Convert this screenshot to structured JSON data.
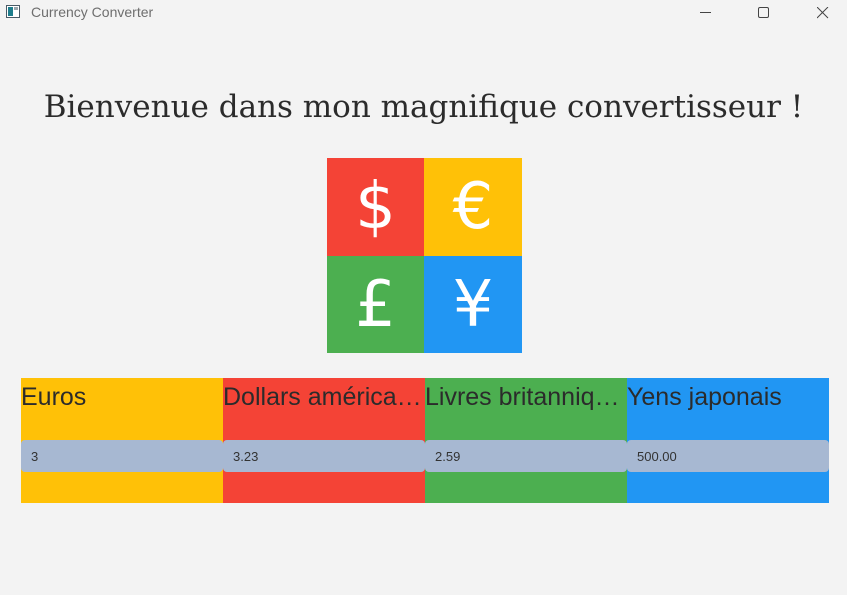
{
  "window": {
    "title": "Currency Converter"
  },
  "heading": "Bienvenue dans mon magnifique convertisseur !",
  "logo": {
    "symbols": [
      "$",
      "€",
      "£",
      "¥"
    ],
    "colors": [
      "#f44336",
      "#ffc107",
      "#4caf50",
      "#2196f3"
    ]
  },
  "currencies": [
    {
      "label": "Euros",
      "value": "3",
      "color": "#ffc107"
    },
    {
      "label": "Dollars américains",
      "value": "3.23",
      "color": "#f44336"
    },
    {
      "label": "Livres britanniques",
      "value": "2.59",
      "color": "#4caf50"
    },
    {
      "label": "Yens japonais",
      "value": "500.00",
      "color": "#2196f3"
    }
  ],
  "input_background": "#a7b8d2",
  "icons": {
    "app": "app-window-icon",
    "minimize": "minimize-icon",
    "maximize": "maximize-icon",
    "close": "close-icon"
  }
}
